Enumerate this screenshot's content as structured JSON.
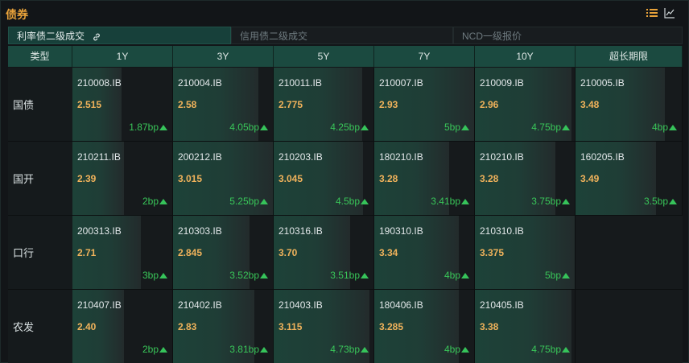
{
  "header": {
    "title": "债券",
    "list_icon": "list-icon",
    "chart_icon": "line-chart-icon"
  },
  "tabs": [
    {
      "label": "利率债二级成交",
      "active": true
    },
    {
      "label": "信用债二级成交",
      "active": false
    },
    {
      "label": "NCD一级报价",
      "active": false
    }
  ],
  "columns": [
    "类型",
    "1Y",
    "3Y",
    "5Y",
    "7Y",
    "10Y",
    "超长期限"
  ],
  "colors": {
    "accent": "#e8a23a",
    "yield": "#f0b25b",
    "up": "#39c659",
    "header_bg": "#1b4a40"
  },
  "rows": [
    {
      "label": "国债",
      "cells": [
        {
          "code": "210008.IB",
          "yield": "2.515",
          "change": "1.87bp",
          "level": 0.37
        },
        {
          "code": "210004.IB",
          "yield": "2.58",
          "change": "4.05bp",
          "level": 0.81
        },
        {
          "code": "210011.IB",
          "yield": "2.775",
          "change": "4.25bp",
          "level": 0.85
        },
        {
          "code": "210007.IB",
          "yield": "2.93",
          "change": "5bp",
          "level": 1.0
        },
        {
          "code": "210009.IB",
          "yield": "2.96",
          "change": "4.75bp",
          "level": 0.95
        },
        {
          "code": "210005.IB",
          "yield": "3.48",
          "change": "4bp",
          "level": 0.8
        }
      ]
    },
    {
      "label": "国开",
      "cells": [
        {
          "code": "210211.IB",
          "yield": "2.39",
          "change": "2bp",
          "level": 0.4
        },
        {
          "code": "200212.IB",
          "yield": "3.015",
          "change": "5.25bp",
          "level": 1.0
        },
        {
          "code": "210203.IB",
          "yield": "3.045",
          "change": "4.5bp",
          "level": 0.86
        },
        {
          "code": "180210.IB",
          "yield": "3.28",
          "change": "3.41bp",
          "level": 0.68
        },
        {
          "code": "210210.IB",
          "yield": "3.28",
          "change": "3.75bp",
          "level": 0.75
        },
        {
          "code": "160205.IB",
          "yield": "3.49",
          "change": "3.5bp",
          "level": 0.7
        }
      ]
    },
    {
      "label": "口行",
      "cells": [
        {
          "code": "200313.IB",
          "yield": "2.71",
          "change": "3bp",
          "level": 0.6
        },
        {
          "code": "210303.IB",
          "yield": "2.845",
          "change": "3.52bp",
          "level": 0.7
        },
        {
          "code": "210316.IB",
          "yield": "3.70",
          "change": "3.51bp",
          "level": 0.7
        },
        {
          "code": "190310.IB",
          "yield": "3.34",
          "change": "4bp",
          "level": 0.8
        },
        {
          "code": "210310.IB",
          "yield": "3.375",
          "change": "5bp",
          "level": 1.0
        },
        null
      ]
    },
    {
      "label": "农发",
      "cells": [
        {
          "code": "210407.IB",
          "yield": "2.40",
          "change": "2bp",
          "level": 0.4
        },
        {
          "code": "210402.IB",
          "yield": "2.83",
          "change": "3.81bp",
          "level": 0.76
        },
        {
          "code": "210403.IB",
          "yield": "3.115",
          "change": "4.73bp",
          "level": 0.94
        },
        {
          "code": "180406.IB",
          "yield": "3.285",
          "change": "4bp",
          "level": 0.8
        },
        {
          "code": "210405.IB",
          "yield": "3.38",
          "change": "4.75bp",
          "level": 0.95
        },
        null
      ]
    }
  ]
}
